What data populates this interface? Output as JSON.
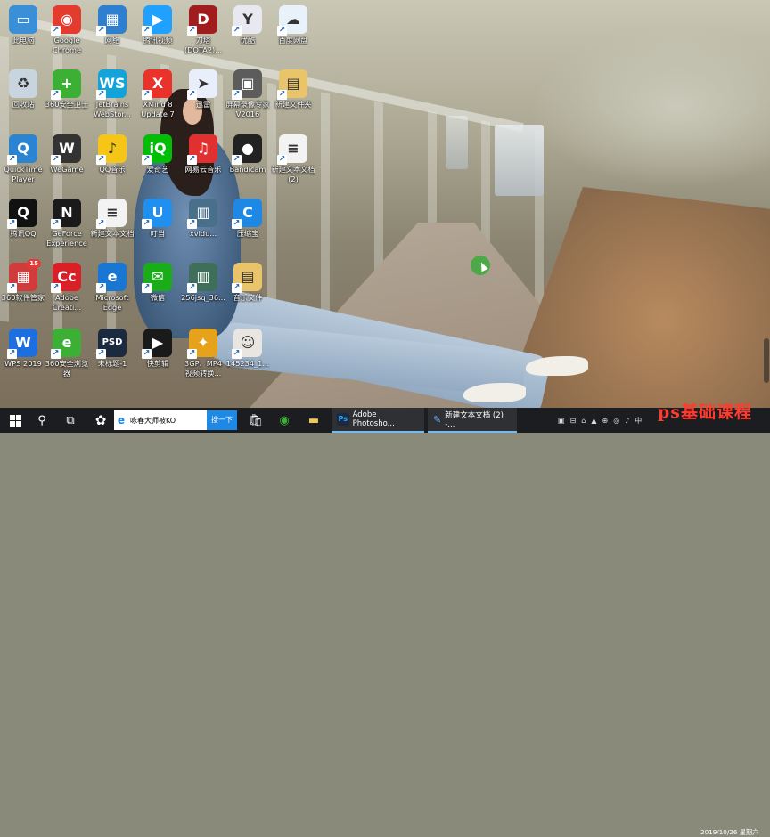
{
  "desktop": {
    "icons": [
      {
        "label": "此电脑",
        "glyph": "▭",
        "color": "#3a8fd6",
        "icon": "computer-icon"
      },
      {
        "label": "Google Chrome",
        "glyph": "◉",
        "color": "#e33b2e",
        "icon": "chrome-icon"
      },
      {
        "label": "网络",
        "glyph": "▦",
        "color": "#2f7fd0",
        "icon": "network-icon"
      },
      {
        "label": "腾讯视频",
        "glyph": "▶",
        "color": "#20a0ff",
        "icon": "tencent-video-icon"
      },
      {
        "label": "刀塔(DOTA2)...",
        "glyph": "D",
        "color": "#a11d1d",
        "icon": "dota2-icon"
      },
      {
        "label": "优酷",
        "glyph": "Y",
        "color": "#e8e8f0",
        "icon": "youku-icon"
      },
      {
        "label": "百度网盘",
        "glyph": "☁",
        "color": "#e8f2fb",
        "icon": "baidu-netdisk-icon"
      },
      {
        "label": "回收站",
        "glyph": "♻",
        "color": "#c9d5de",
        "icon": "recycle-bin-icon"
      },
      {
        "label": "360安全卫士",
        "glyph": "+",
        "color": "#3cb034",
        "icon": "360-security-icon"
      },
      {
        "label": "JetBrains WebStor...",
        "glyph": "WS",
        "color": "#13a3d8",
        "icon": "webstorm-icon"
      },
      {
        "label": "XMind 8 Update 7",
        "glyph": "X",
        "color": "#e8322a",
        "icon": "xmind-icon"
      },
      {
        "label": "迅雷",
        "glyph": "➤",
        "color": "#e9eefb",
        "icon": "thunder-icon"
      },
      {
        "label": "屏幕录像专家V2016",
        "glyph": "▣",
        "color": "#5c5c5c",
        "icon": "screen-recorder-icon"
      },
      {
        "label": "新建文件夹",
        "glyph": "▤",
        "color": "#e9c46a",
        "icon": "folder-icon"
      },
      {
        "label": "QuickTime Player",
        "glyph": "Q",
        "color": "#2a84d2",
        "icon": "quicktime-icon"
      },
      {
        "label": "WeGame",
        "glyph": "W",
        "color": "#333333",
        "icon": "wegame-icon"
      },
      {
        "label": "QQ音乐",
        "glyph": "♪",
        "color": "#f5c518",
        "icon": "qq-music-icon"
      },
      {
        "label": "爱奇艺",
        "glyph": "iQ",
        "color": "#00be06",
        "icon": "iqiyi-icon"
      },
      {
        "label": "网易云音乐",
        "glyph": "♫",
        "color": "#e03030",
        "icon": "netease-music-icon"
      },
      {
        "label": "Bandicam",
        "glyph": "●",
        "color": "#222222",
        "icon": "bandicam-icon"
      },
      {
        "label": "新建文本文档 (2)",
        "glyph": "≡",
        "color": "#f3f3f3",
        "icon": "text-document-icon"
      },
      {
        "label": "腾讯QQ",
        "glyph": "Q",
        "color": "#111111",
        "icon": "qq-icon"
      },
      {
        "label": "GeForce Experience",
        "glyph": "N",
        "color": "#1a1a1a",
        "icon": "geforce-icon"
      },
      {
        "label": "新建文本文档",
        "glyph": "≡",
        "color": "#f3f3f3",
        "icon": "text-document-icon"
      },
      {
        "label": "叮当",
        "glyph": "U",
        "color": "#1f8ff0",
        "icon": "dingdang-icon"
      },
      {
        "label": "xvidu...",
        "glyph": "▥",
        "color": "#4a6f8a",
        "icon": "video-file-icon"
      },
      {
        "label": "压缩宝",
        "glyph": "C",
        "color": "#1e88e5",
        "icon": "compress-icon"
      },
      {
        "label": "360软件管家",
        "glyph": "▦",
        "color": "#d23b3b",
        "icon": "360-software-icon",
        "badge": "15"
      },
      {
        "label": "Adobe Creati...",
        "glyph": "Cc",
        "color": "#da1f26",
        "icon": "adobe-cc-icon"
      },
      {
        "label": "Microsoft Edge",
        "glyph": "e",
        "color": "#1976d2",
        "icon": "edge-icon"
      },
      {
        "label": "微信",
        "glyph": "✉",
        "color": "#1aad19",
        "icon": "wechat-icon"
      },
      {
        "label": "256jsq_36...",
        "glyph": "▥",
        "color": "#3f6f5a",
        "icon": "video-file-icon"
      },
      {
        "label": "音乐文件",
        "glyph": "▤",
        "color": "#e9c46a",
        "icon": "folder-icon"
      },
      {
        "label": "WPS 2019",
        "glyph": "W",
        "color": "#1d6fe0",
        "icon": "wps-icon"
      },
      {
        "label": "360安全浏览器",
        "glyph": "e",
        "color": "#3cb034",
        "icon": "360-browser-icon"
      },
      {
        "label": "未标题-1",
        "glyph": "PSD",
        "color": "#1b2a3f",
        "icon": "psd-file-icon"
      },
      {
        "label": "快剪辑",
        "glyph": "▶",
        "color": "#1a1a1a",
        "icon": "kuaijianji-icon"
      },
      {
        "label": "3GP、MP4视频转换...",
        "glyph": "✦",
        "color": "#e7a21c",
        "icon": "video-converter-icon"
      },
      {
        "label": "145234_1...",
        "glyph": "☺",
        "color": "#e9e6e1",
        "icon": "photo-icon"
      }
    ]
  },
  "taskbar": {
    "search_text": "咏春大师被KO",
    "search_go": "搜一下",
    "tasks": [
      {
        "label": "Adobe Photosho...",
        "icon": "Ps",
        "color": "#1b2a3f"
      },
      {
        "label": "新建文本文档 (2) -...",
        "icon": "✎",
        "color": "#4f8fd8"
      }
    ],
    "tray_items": [
      "▣",
      "⊟",
      "⌂",
      "▲",
      "⊕",
      "◎",
      "♪",
      "中"
    ],
    "clock_date": "2019/10/26 星期六",
    "watermark": "ps基础课程"
  },
  "colors": {
    "taskbar_bg": "#1c1d20",
    "accent": "#1e88e5",
    "watermark": "#ff3b2f"
  }
}
